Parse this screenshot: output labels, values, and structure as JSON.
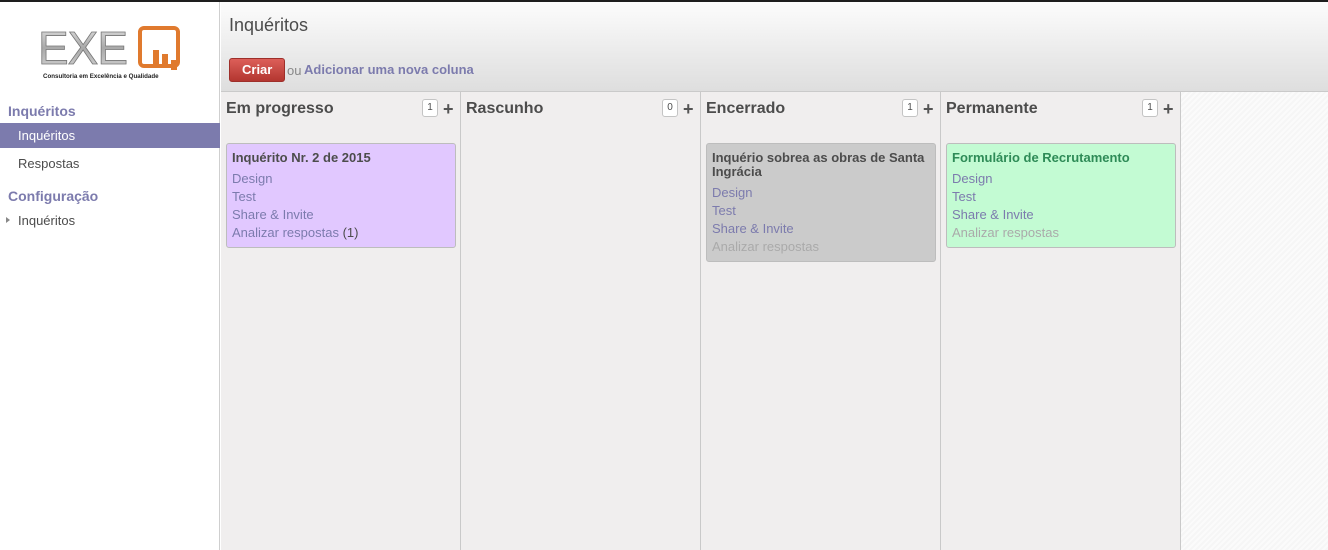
{
  "sidebar": {
    "logo": {
      "brand": "EXEQ",
      "tagline": "Consultoria em Excelência e Qualidade"
    },
    "sections": [
      {
        "header": "Inquéritos",
        "items": [
          {
            "label": "Inquéritos"
          },
          {
            "label": "Respostas"
          }
        ]
      },
      {
        "header": "Configuração",
        "items": [
          {
            "label": "Inquéritos"
          }
        ]
      }
    ]
  },
  "header": {
    "title": "Inquéritos",
    "create_label": "Criar",
    "or_label": "ou",
    "add_column_label": "Adicionar uma nova coluna"
  },
  "columns": [
    {
      "title": "Em progresso",
      "count": "1",
      "cards": [
        {
          "title": "Inquérito Nr. 2 de 2015",
          "links": [
            "Design",
            "Test",
            "Share & Invite"
          ],
          "analyze": "Analizar respostas",
          "analyze_count": "(1)"
        }
      ]
    },
    {
      "title": "Rascunho",
      "count": "0",
      "cards": []
    },
    {
      "title": "Encerrado",
      "count": "1",
      "cards": [
        {
          "title": "Inquério sobrea as obras de Santa Ingrácia",
          "links": [
            "Design",
            "Test",
            "Share & Invite"
          ],
          "analyze": "Analizar respostas"
        }
      ]
    },
    {
      "title": "Permanente",
      "count": "1",
      "cards": [
        {
          "title": "Formulário de Recrutamento",
          "links": [
            "Design",
            "Test",
            "Share & Invite"
          ],
          "analyze": "Analizar respostas"
        }
      ]
    }
  ],
  "colors": {
    "accent": "#7c7bad",
    "create_button": "#c9423c",
    "card_purple": "#e1c8ff",
    "card_gray": "#cbcbcb",
    "card_green": "#c3fbd3",
    "green_title": "#2e8b57"
  },
  "icons": {
    "column_add": "plus-icon",
    "menu_expand": "triangle-right-icon"
  }
}
